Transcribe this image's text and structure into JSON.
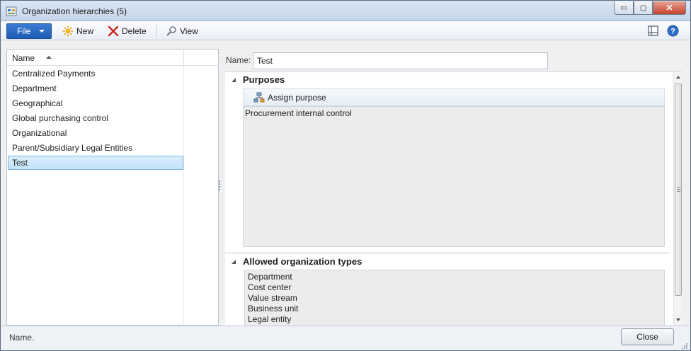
{
  "window": {
    "title": "Organization hierarchies (5)",
    "controls": {
      "minimize": "▭",
      "maximize": "▢",
      "close": "✕"
    }
  },
  "toolbar": {
    "file_label": "File",
    "new_label": "New",
    "delete_label": "Delete",
    "view_label": "View",
    "icons": [
      "new-star-icon",
      "delete-x-icon",
      "view-magnifier-icon",
      "layout-pane-icon",
      "help-icon"
    ]
  },
  "list": {
    "column_header": "Name",
    "sort": "ascending",
    "items": [
      {
        "label": "Centralized Payments",
        "selected": false
      },
      {
        "label": "Department",
        "selected": false
      },
      {
        "label": "Geographical",
        "selected": false
      },
      {
        "label": "Global purchasing control",
        "selected": false
      },
      {
        "label": "Organizational",
        "selected": false
      },
      {
        "label": "Parent/Subsidiary Legal Entities",
        "selected": false
      },
      {
        "label": "Test",
        "selected": true
      }
    ]
  },
  "detail": {
    "name_label": "Name:",
    "name_value": "Test",
    "purposes": {
      "title": "Purposes",
      "assign_label": "Assign purpose",
      "rows": [
        "Procurement internal control"
      ]
    },
    "allowed_types": {
      "title": "Allowed organization types",
      "rows": [
        "Department",
        "Cost center",
        "Value stream",
        "Business unit",
        "Legal entity"
      ]
    }
  },
  "status": {
    "text": "Name.",
    "close_label": "Close"
  },
  "colors": {
    "file_button": "#1e5cb3",
    "selection": "#c3e3f8",
    "close_button": "#c7412c"
  }
}
